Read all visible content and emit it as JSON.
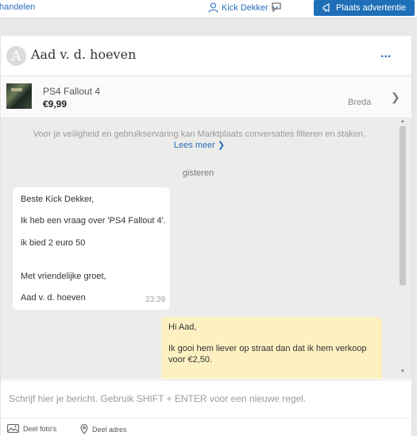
{
  "topbar": {
    "left_link": "handelen",
    "user_name": "Kick Dekker",
    "post_button": "Plaats advertentie"
  },
  "conversation": {
    "contact_initial": "A",
    "contact_name": "Aad v. d. hoeven",
    "more_label": "...",
    "listing": {
      "title": "PS4 Fallout 4",
      "price": "€9,99",
      "city": "Breda"
    },
    "notice": "Voor je veiligheid en gebruikservaring kan Marktplaats conversaties filteren en staken.",
    "notice_link": "Lees meer",
    "date_divider": "gisteren",
    "incoming": {
      "lines": [
        "Beste Kick Dekker,",
        "Ik heb een vraag over 'PS4 Fallout 4'.",
        "ik bied 2 euro 50",
        "Met vriendelijke groet,",
        "Aad v. d. hoeven"
      ],
      "time": "23:39"
    },
    "outgoing": {
      "lines": [
        "Hi Aad,",
        "Ik gooi hem liever op straat dan dat ik hem verkoop voor €2,50."
      ]
    },
    "composer_placeholder": "Schrijf hier je bericht. Gebruik SHIFT + ENTER voor een nieuwe regel.",
    "actions": {
      "photos": "Deel foto's",
      "address": "Deel adres"
    }
  },
  "colors": {
    "brand_blue": "#1e6fb8",
    "link_blue": "#2a6ebb",
    "outgoing_bubble": "#fdf1c2"
  }
}
